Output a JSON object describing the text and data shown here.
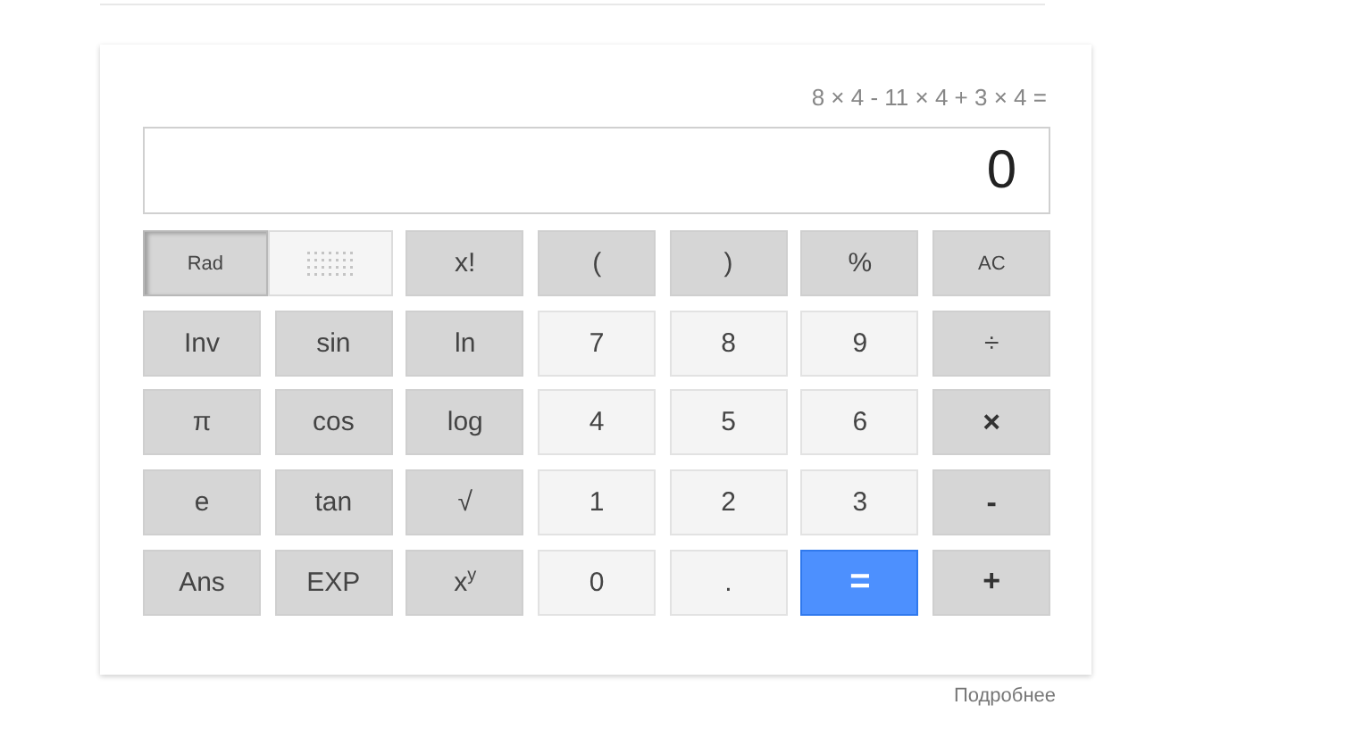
{
  "expression": "8 × 4 - 11 × 4 + 3 × 4 =",
  "display": "0",
  "angle_modes": [
    {
      "label": "Rad",
      "selected": true
    },
    {
      "kind": "blurred",
      "selected": false
    }
  ],
  "keys": [
    {
      "label": "x!",
      "kind": "func"
    },
    {
      "label": "(",
      "kind": "func"
    },
    {
      "label": ")",
      "kind": "func"
    },
    {
      "label": "%",
      "kind": "func"
    },
    {
      "label": "AC",
      "kind": "small"
    },
    {
      "label": "Inv",
      "kind": "func"
    },
    {
      "label": "sin",
      "kind": "func"
    },
    {
      "label": "ln",
      "kind": "func"
    },
    {
      "label": "7",
      "kind": "digit"
    },
    {
      "label": "8",
      "kind": "digit"
    },
    {
      "label": "9",
      "kind": "digit"
    },
    {
      "label": "÷",
      "kind": "func"
    },
    {
      "label": "π",
      "kind": "func"
    },
    {
      "label": "cos",
      "kind": "func"
    },
    {
      "label": "log",
      "kind": "func"
    },
    {
      "label": "4",
      "kind": "digit"
    },
    {
      "label": "5",
      "kind": "digit"
    },
    {
      "label": "6",
      "kind": "digit"
    },
    {
      "label": "×",
      "kind": "op"
    },
    {
      "label": "e",
      "kind": "func"
    },
    {
      "label": "tan",
      "kind": "func"
    },
    {
      "label": "√",
      "kind": "func"
    },
    {
      "label": "1",
      "kind": "digit"
    },
    {
      "label": "2",
      "kind": "digit"
    },
    {
      "label": "3",
      "kind": "digit"
    },
    {
      "label": "-",
      "kind": "op"
    },
    {
      "label": "Ans",
      "kind": "func"
    },
    {
      "label": "EXP",
      "kind": "func"
    },
    {
      "label": "x$^{y}$",
      "kind": "func"
    },
    {
      "label": "0",
      "kind": "digit"
    },
    {
      "label": ".",
      "kind": "digit"
    },
    {
      "label": "=",
      "kind": "equals"
    },
    {
      "label": "+",
      "kind": "op"
    }
  ],
  "more_link": "Подробнее"
}
